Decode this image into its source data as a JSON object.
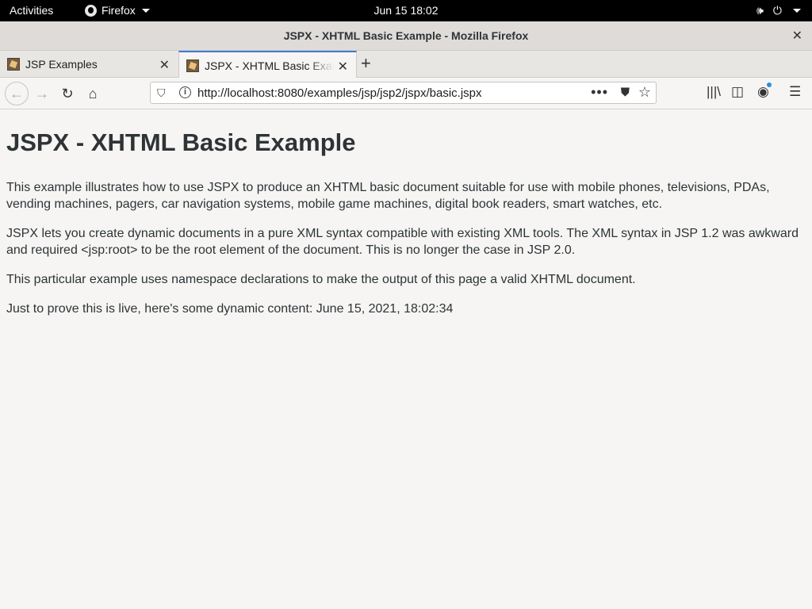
{
  "topbar": {
    "activities": "Activities",
    "app_name": "Firefox",
    "clock": "Jun 15  18:02"
  },
  "window": {
    "title": "JSPX - XHTML Basic Example - Mozilla Firefox",
    "close_glyph": "✕"
  },
  "tabs": [
    {
      "label": "JSP Examples",
      "active": false
    },
    {
      "label": "JSPX - XHTML Basic Example",
      "active": true
    }
  ],
  "navbar": {
    "url": "http://localhost:8080/examples/jsp/jsp2/jspx/basic.jspx"
  },
  "page": {
    "heading": "JSPX - XHTML Basic Example",
    "paragraphs": [
      "This example illustrates how to use JSPX to produce an XHTML basic document suitable for use with mobile phones, televisions, PDAs, vending machines, pagers, car navigation systems, mobile game machines, digital book readers, smart watches, etc.",
      "JSPX lets you create dynamic documents in a pure XML syntax compatible with existing XML tools. The XML syntax in JSP 1.2 was awkward and required <jsp:root> to be the root element of the document. This is no longer the case in JSP 2.0.",
      "This particular example uses namespace declarations to make the output of this page a valid XHTML document.",
      "Just to prove this is live, here's some dynamic content: June 15, 2021, 18:02:34"
    ]
  },
  "icons": {
    "back": "back-arrow-icon",
    "forward": "forward-arrow-icon",
    "reload": "reload-icon",
    "home": "home-icon",
    "accent": "#3b7cd1"
  }
}
